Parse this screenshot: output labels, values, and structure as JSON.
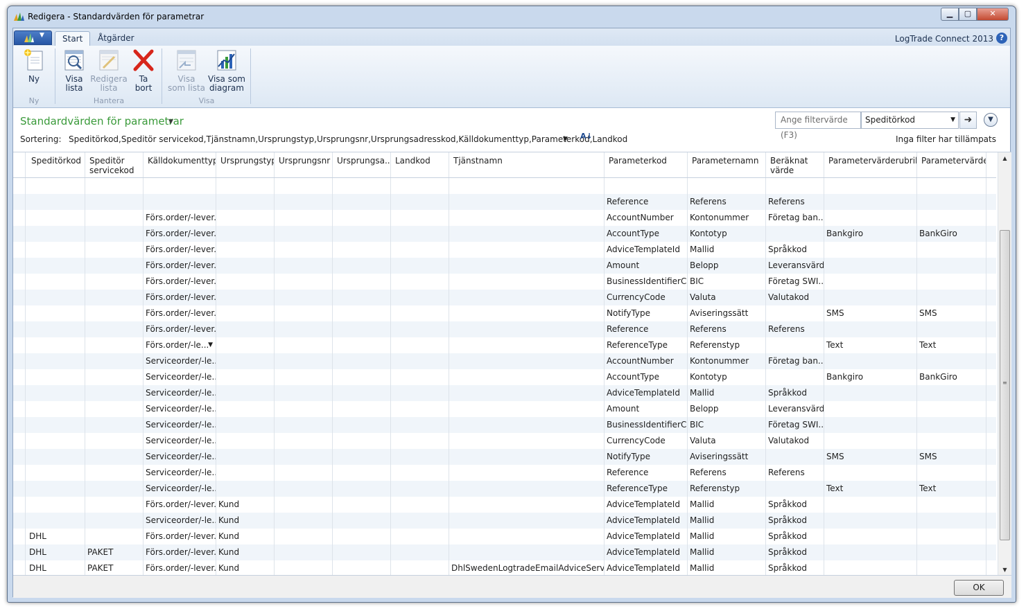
{
  "window": {
    "title": "Redigera - Standardvärden för parametrar",
    "minimize": "▁",
    "maximize": "▢",
    "close": "✕"
  },
  "ribbon": {
    "tabs": [
      "Start",
      "Åtgärder"
    ],
    "product": "LogTrade Connect 2013",
    "help": "?",
    "buttons": {
      "ny": "Ny",
      "visa_lista_1": "Visa",
      "visa_lista_2": "lista",
      "redigera_lista_1": "Redigera",
      "redigera_lista_2": "lista",
      "ta_bort_1": "Ta",
      "ta_bort_2": "bort",
      "visa_som_lista_1": "Visa",
      "visa_som_lista_2": "som lista",
      "visa_som_diagram_1": "Visa som",
      "visa_som_diagram_2": "diagram"
    },
    "groups": {
      "ny": "Ny",
      "hantera": "Hantera",
      "visa": "Visa"
    }
  },
  "page": {
    "title": "Standardvärden för parametrar",
    "filter_placeholder": "Ange filtervärde (F3)",
    "filter_field": "Speditörkod",
    "sort_label": "Sortering:",
    "sort_value": "Speditörkod,Speditör servicekod,Tjänstnamn,Ursprungstyp,Ursprungsnr,Ursprungsadresskod,Källdokumenttyp,Parameterkod,Landkod",
    "filter_status": "Inga filter har tillämpats"
  },
  "grid": {
    "columns": [
      {
        "l1": "Speditörkod",
        "l2": ""
      },
      {
        "l1": "Speditör",
        "l2": "servicekod"
      },
      {
        "l1": "Källdokumenttyp",
        "l2": ""
      },
      {
        "l1": "Ursprungstyp",
        "l2": ""
      },
      {
        "l1": "Ursprungsnr",
        "l2": ""
      },
      {
        "l1": "Ursprungsa...",
        "l2": ""
      },
      {
        "l1": "Landkod",
        "l2": ""
      },
      {
        "l1": "Tjänstnamn",
        "l2": ""
      },
      {
        "l1": "Parameterkod",
        "l2": ""
      },
      {
        "l1": "Parameternamn",
        "l2": ""
      },
      {
        "l1": "Beräknat",
        "l2": "värde"
      },
      {
        "l1": "Parametervärderubrik",
        "l2": ""
      },
      {
        "l1": "Parametervärde",
        "l2": ""
      }
    ],
    "rows": [
      [
        "",
        "",
        "",
        "",
        "",
        "",
        "",
        "",
        "",
        "",
        "",
        "",
        ""
      ],
      [
        "",
        "",
        "",
        "",
        "",
        "",
        "",
        "",
        "Reference",
        "Referens",
        "Referens",
        "",
        ""
      ],
      [
        "",
        "",
        "Förs.order/-lever...",
        "",
        "",
        "",
        "",
        "",
        "AccountNumber",
        "Kontonummer",
        "Företag ban...",
        "",
        ""
      ],
      [
        "",
        "",
        "Förs.order/-lever...",
        "",
        "",
        "",
        "",
        "",
        "AccountType",
        "Kontotyp",
        "",
        "Bankgiro",
        "BankGiro"
      ],
      [
        "",
        "",
        "Förs.order/-lever...",
        "",
        "",
        "",
        "",
        "",
        "AdviceTemplateId",
        "Mallid",
        "Språkkod",
        "",
        ""
      ],
      [
        "",
        "",
        "Förs.order/-lever...",
        "",
        "",
        "",
        "",
        "",
        "Amount",
        "Belopp",
        "Leveransvärde",
        "",
        ""
      ],
      [
        "",
        "",
        "Förs.order/-lever...",
        "",
        "",
        "",
        "",
        "",
        "BusinessIdentifierC...",
        "BIC",
        "Företag SWI...",
        "",
        ""
      ],
      [
        "",
        "",
        "Förs.order/-lever...",
        "",
        "",
        "",
        "",
        "",
        "CurrencyCode",
        "Valuta",
        "Valutakod",
        "",
        ""
      ],
      [
        "",
        "",
        "Förs.order/-lever...",
        "",
        "",
        "",
        "",
        "",
        "NotifyType",
        "Aviseringssätt",
        "",
        "SMS",
        "SMS"
      ],
      [
        "",
        "",
        "Förs.order/-lever...",
        "",
        "",
        "",
        "",
        "",
        "Reference",
        "Referens",
        "Referens",
        "",
        ""
      ],
      [
        "",
        "",
        "Förs.order/-le...",
        "",
        "",
        "",
        "",
        "",
        "ReferenceType",
        "Referenstyp",
        "",
        "Text",
        "Text"
      ],
      [
        "",
        "",
        "Serviceorder/-le...",
        "",
        "",
        "",
        "",
        "",
        "AccountNumber",
        "Kontonummer",
        "Företag ban...",
        "",
        ""
      ],
      [
        "",
        "",
        "Serviceorder/-le...",
        "",
        "",
        "",
        "",
        "",
        "AccountType",
        "Kontotyp",
        "",
        "Bankgiro",
        "BankGiro"
      ],
      [
        "",
        "",
        "Serviceorder/-le...",
        "",
        "",
        "",
        "",
        "",
        "AdviceTemplateId",
        "Mallid",
        "Språkkod",
        "",
        ""
      ],
      [
        "",
        "",
        "Serviceorder/-le...",
        "",
        "",
        "",
        "",
        "",
        "Amount",
        "Belopp",
        "Leveransvärde",
        "",
        ""
      ],
      [
        "",
        "",
        "Serviceorder/-le...",
        "",
        "",
        "",
        "",
        "",
        "BusinessIdentifierC...",
        "BIC",
        "Företag SWI...",
        "",
        ""
      ],
      [
        "",
        "",
        "Serviceorder/-le...",
        "",
        "",
        "",
        "",
        "",
        "CurrencyCode",
        "Valuta",
        "Valutakod",
        "",
        ""
      ],
      [
        "",
        "",
        "Serviceorder/-le...",
        "",
        "",
        "",
        "",
        "",
        "NotifyType",
        "Aviseringssätt",
        "",
        "SMS",
        "SMS"
      ],
      [
        "",
        "",
        "Serviceorder/-le...",
        "",
        "",
        "",
        "",
        "",
        "Reference",
        "Referens",
        "Referens",
        "",
        ""
      ],
      [
        "",
        "",
        "Serviceorder/-le...",
        "",
        "",
        "",
        "",
        "",
        "ReferenceType",
        "Referenstyp",
        "",
        "Text",
        "Text"
      ],
      [
        "",
        "",
        "Förs.order/-lever...",
        "Kund",
        "",
        "",
        "",
        "",
        "AdviceTemplateId",
        "Mallid",
        "Språkkod",
        "",
        ""
      ],
      [
        "",
        "",
        "Serviceorder/-le...",
        "Kund",
        "",
        "",
        "",
        "",
        "AdviceTemplateId",
        "Mallid",
        "Språkkod",
        "",
        ""
      ],
      [
        "DHL",
        "",
        "Förs.order/-lever...",
        "Kund",
        "",
        "",
        "",
        "",
        "AdviceTemplateId",
        "Mallid",
        "Språkkod",
        "",
        ""
      ],
      [
        "DHL",
        "PAKET",
        "Förs.order/-lever...",
        "Kund",
        "",
        "",
        "",
        "",
        "AdviceTemplateId",
        "Mallid",
        "Språkkod",
        "",
        ""
      ],
      [
        "DHL",
        "PAKET",
        "Förs.order/-lever...",
        "Kund",
        "",
        "",
        "",
        "DhlSwedenLogtradeEmailAdviceService",
        "AdviceTemplateId",
        "Mallid",
        "Språkkod",
        "",
        ""
      ]
    ]
  },
  "footer": {
    "ok": "OK"
  }
}
